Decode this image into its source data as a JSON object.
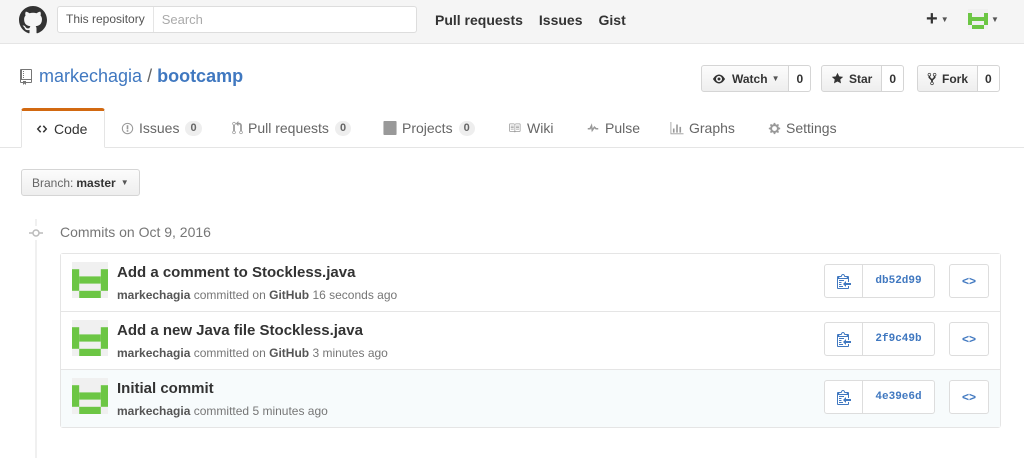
{
  "header": {
    "search_scope": "This repository",
    "search_placeholder": "Search",
    "nav": [
      "Pull requests",
      "Issues",
      "Gist"
    ],
    "plus_symbol": "+",
    "icons": [
      "github-logo-icon",
      "plus-icon",
      "avatar-icon"
    ]
  },
  "repo": {
    "owner": "markechagia",
    "separator": "/",
    "name": "bootcamp",
    "watch_label": "Watch",
    "watch_count": "0",
    "star_label": "Star",
    "star_count": "0",
    "fork_label": "Fork",
    "fork_count": "0"
  },
  "tabs": [
    {
      "label": "Code",
      "icon": "code-icon"
    },
    {
      "label": "Issues",
      "count": "0",
      "icon": "issue-icon"
    },
    {
      "label": "Pull requests",
      "count": "0",
      "icon": "pull-request-icon"
    },
    {
      "label": "Projects",
      "count": "0",
      "icon": "project-icon"
    },
    {
      "label": "Wiki",
      "icon": "book-icon"
    },
    {
      "label": "Pulse",
      "icon": "pulse-icon"
    },
    {
      "label": "Graphs",
      "icon": "graph-icon"
    },
    {
      "label": "Settings",
      "icon": "gear-icon"
    }
  ],
  "branch": {
    "prefix": "Branch:",
    "name": "master"
  },
  "commits_heading": "Commits on Oct 9, 2016",
  "commits": [
    {
      "message": "Add a comment to Stockless.java",
      "author": "markechagia",
      "verb": "committed on",
      "via": "GitHub",
      "time": "16 seconds ago",
      "sha": "db52d99"
    },
    {
      "message": "Add a new Java file Stockless.java",
      "author": "markechagia",
      "verb": "committed on",
      "via": "GitHub",
      "time": "3 minutes ago",
      "sha": "2f9c49b"
    },
    {
      "message": "Initial commit",
      "author": "markechagia",
      "verb": "committed",
      "via": "",
      "time": "5 minutes ago",
      "sha": "4e39e6d"
    }
  ],
  "browse_symbol": "<>",
  "colors": {
    "accent": "#4078c0",
    "tab_highlight": "#d26911",
    "avatar_green": "#6cc644"
  }
}
